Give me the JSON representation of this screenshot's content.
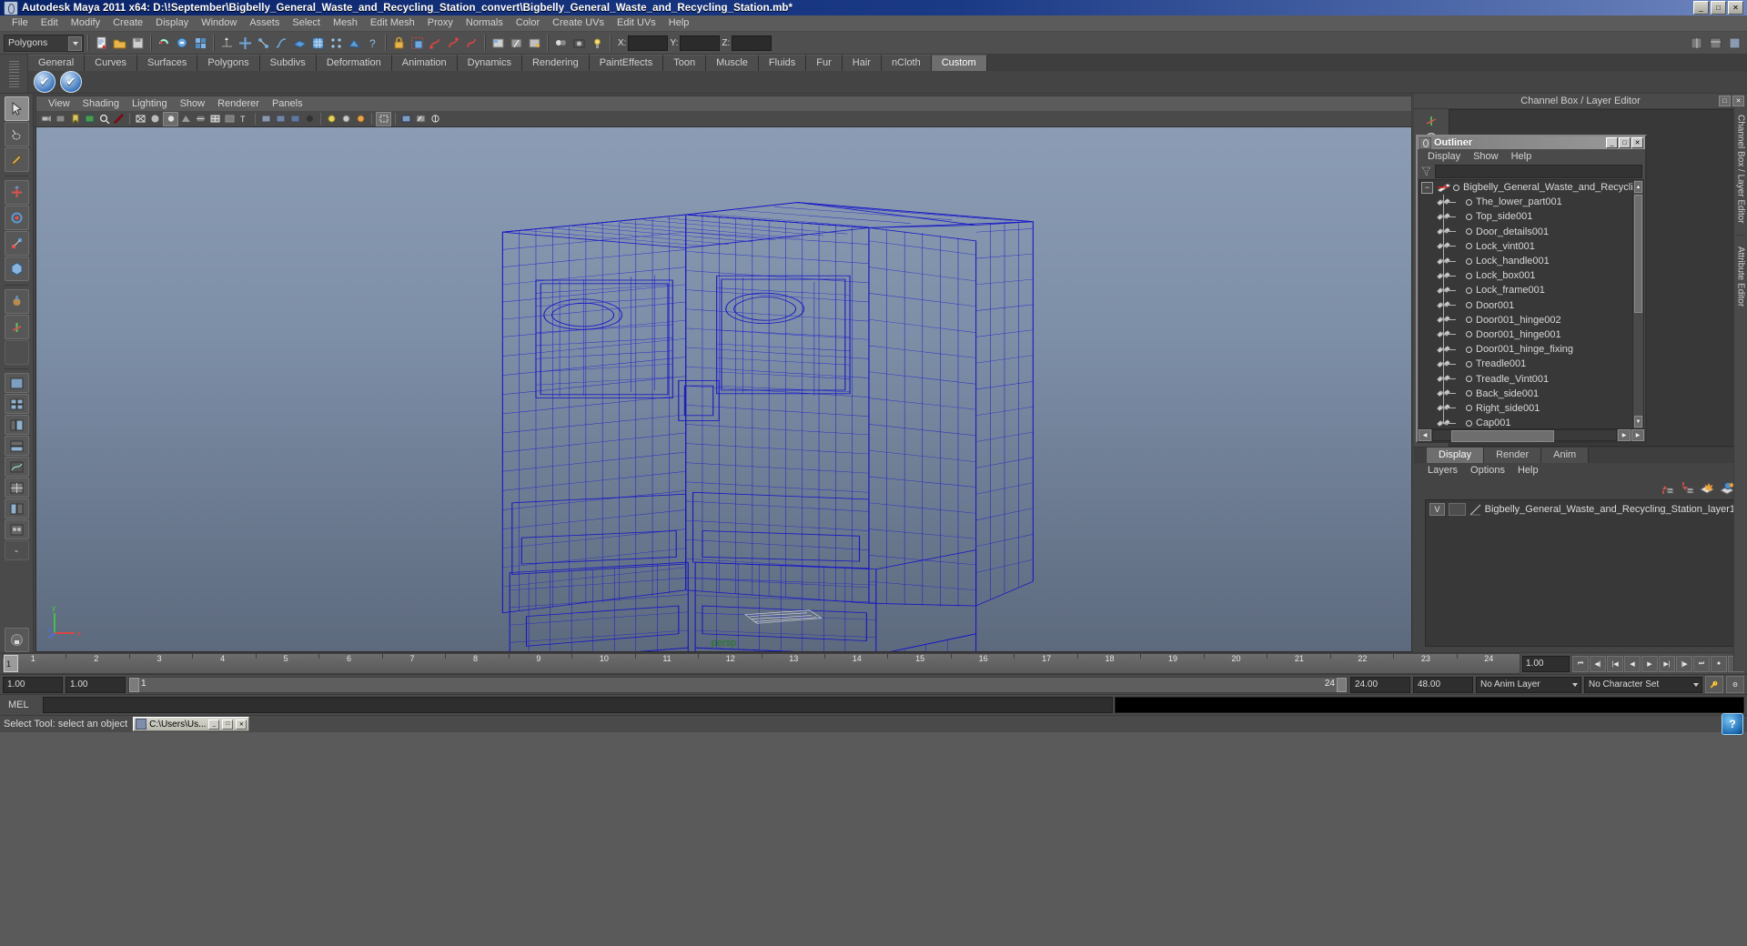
{
  "window": {
    "title": "Autodesk Maya 2011 x64: D:\\!September\\Bigbelly_General_Waste_and_Recycling_Station_convert\\Bigbelly_General_Waste_and_Recycling_Station.mb*",
    "minimize": "_",
    "maximize": "□",
    "close": "✕"
  },
  "menubar": [
    "File",
    "Edit",
    "Modify",
    "Create",
    "Display",
    "Window",
    "Assets",
    "Select",
    "Mesh",
    "Edit Mesh",
    "Proxy",
    "Normals",
    "Color",
    "Create UVs",
    "Edit UVs",
    "Help"
  ],
  "toolbar": {
    "mode_selector": "Polygons",
    "axis_labels": {
      "x": "X:",
      "y": "Y:",
      "z": "Z:"
    },
    "axis_values": {
      "x": "",
      "y": "",
      "z": ""
    }
  },
  "shelf": {
    "tabs": [
      "General",
      "Curves",
      "Surfaces",
      "Polygons",
      "Subdivs",
      "Deformation",
      "Animation",
      "Dynamics",
      "Rendering",
      "PaintEffects",
      "Toon",
      "Muscle",
      "Fluids",
      "Fur",
      "Hair",
      "nCloth",
      "Custom"
    ],
    "active_tab": "Custom",
    "items": [
      "shelf-icon-1",
      "shelf-icon-2"
    ]
  },
  "viewport": {
    "menus": [
      "View",
      "Shading",
      "Lighting",
      "Show",
      "Renderer",
      "Panels"
    ],
    "camera_label": "persp",
    "axis": {
      "x": "x",
      "y": "y",
      "z": "z"
    },
    "wireframe_color": "#1313c8",
    "background_top": "#8b9cb4",
    "background_bottom": "#5d6a7e"
  },
  "channel_box": {
    "header_title": "Channel Box / Layer Editor"
  },
  "outliner": {
    "title": "Outliner",
    "menus": [
      "Display",
      "Show",
      "Help"
    ],
    "search_value": "",
    "window_buttons": [
      "_",
      "□",
      "✕"
    ],
    "root": "Bigbelly_General_Waste_and_Recycling_St...",
    "items": [
      "The_lower_part001",
      "Top_side001",
      "Door_details001",
      "Lock_vint001",
      "Lock_handle001",
      "Lock_box001",
      "Lock_frame001",
      "Door001",
      "Door001_hinge002",
      "Door001_hinge001",
      "Door001_hinge_fixing",
      "Treadle001",
      "Treadle_Vint001",
      "Back_side001",
      "Right_side001",
      "Cap001"
    ]
  },
  "layer_editor": {
    "tabs": [
      "Display",
      "Render",
      "Anim"
    ],
    "active_tab": "Display",
    "menus": [
      "Layers",
      "Options",
      "Help"
    ],
    "layers": [
      {
        "visibility": "V",
        "playback": "",
        "name": "Bigbelly_General_Waste_and_Recycling_Station_layer1"
      }
    ]
  },
  "side_docks": [
    "Channel Box / Layer Editor",
    "Attribute Editor"
  ],
  "time_slider": {
    "ticks": [
      "1",
      "2",
      "3",
      "4",
      "5",
      "6",
      "7",
      "8",
      "9",
      "10",
      "11",
      "12",
      "13",
      "14",
      "15",
      "16",
      "17",
      "18",
      "19",
      "20",
      "21",
      "22",
      "23",
      "24"
    ],
    "current_frame": "1",
    "current_time_field": "1.00",
    "buttons": [
      "⏮",
      "◀▏",
      "▏◀",
      "◀",
      "▶",
      "▶▕",
      "▕▶",
      "⏭",
      "●"
    ]
  },
  "range_slider": {
    "start": "1.00",
    "end": "1.00",
    "range_start_label": "1",
    "range_end_label": "24",
    "playback_end": "24.00",
    "anim_end": "48.00",
    "anim_layer": "No Anim Layer",
    "character_set": "No Character Set"
  },
  "command_line": {
    "label": "MEL",
    "input_value": "",
    "output_value": ""
  },
  "status_bar": {
    "message": "Select Tool: select an object",
    "taskbar_item": "C:\\Users\\Us...",
    "taskbar_buttons": [
      "_",
      "□",
      "✕"
    ],
    "help_icon": "?"
  }
}
